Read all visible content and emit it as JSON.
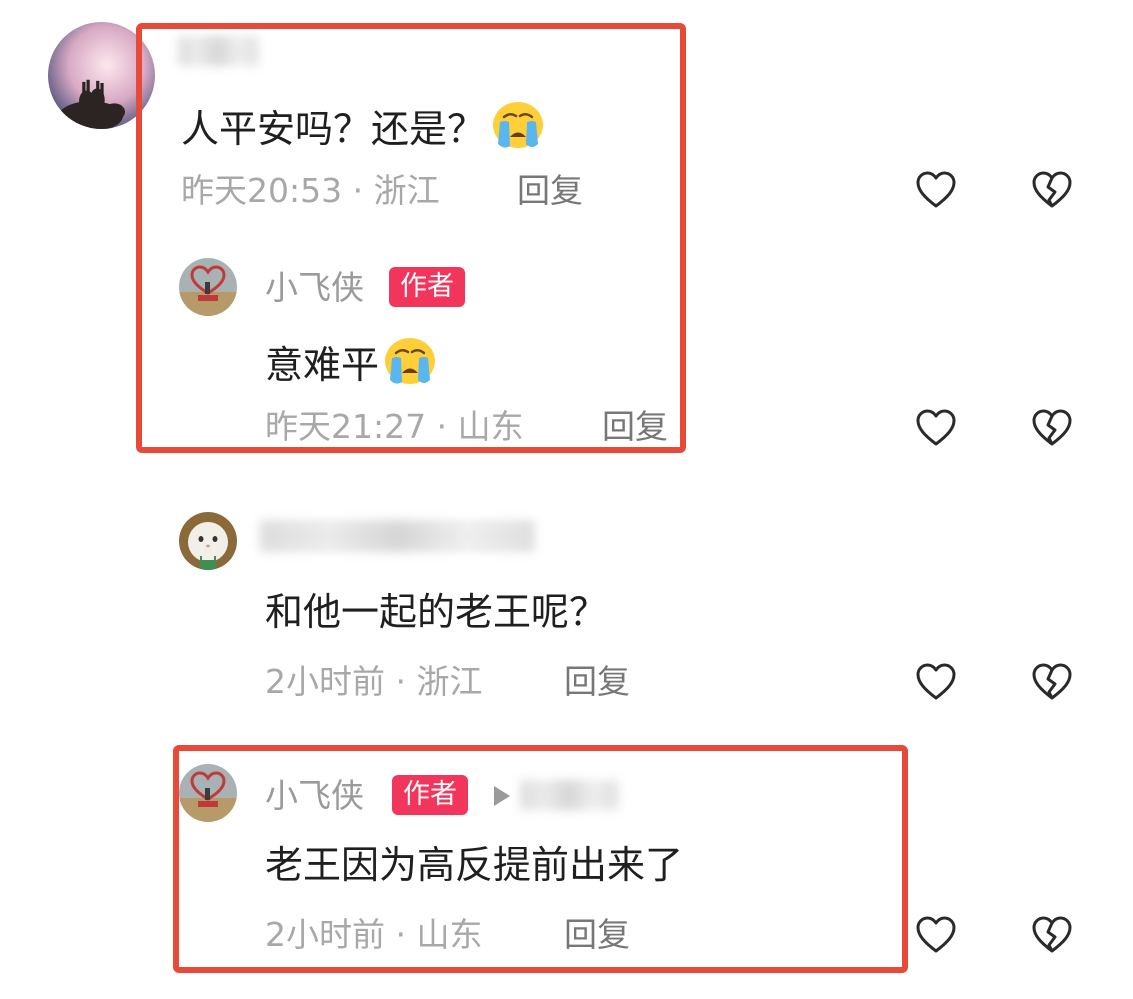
{
  "comments": [
    {
      "text": "人平安吗？还是？",
      "emoji": "crying-face-emoji",
      "meta": "昨天20:53 · 浙江",
      "reply_label": "回复"
    },
    {
      "author": "小飞侠",
      "badge": "作者",
      "text": "意难平",
      "emoji": "crying-face-emoji",
      "meta": "昨天21:27 · 山东",
      "reply_label": "回复"
    },
    {
      "text": "和他一起的老王呢？",
      "meta": "2小时前 · 浙江",
      "reply_label": "回复"
    },
    {
      "author": "小飞侠",
      "badge": "作者",
      "text": "老王因为高反提前出来了",
      "meta": "2小时前 · 山东",
      "reply_label": "回复"
    }
  ],
  "icons": {
    "like": "heart-outline-icon",
    "dislike": "broken-heart-icon"
  },
  "colors": {
    "badge": "#f2355a",
    "highlight": "#e84a3a",
    "meta_text": "#a8a8a8",
    "name_text": "#9a9a9a"
  }
}
